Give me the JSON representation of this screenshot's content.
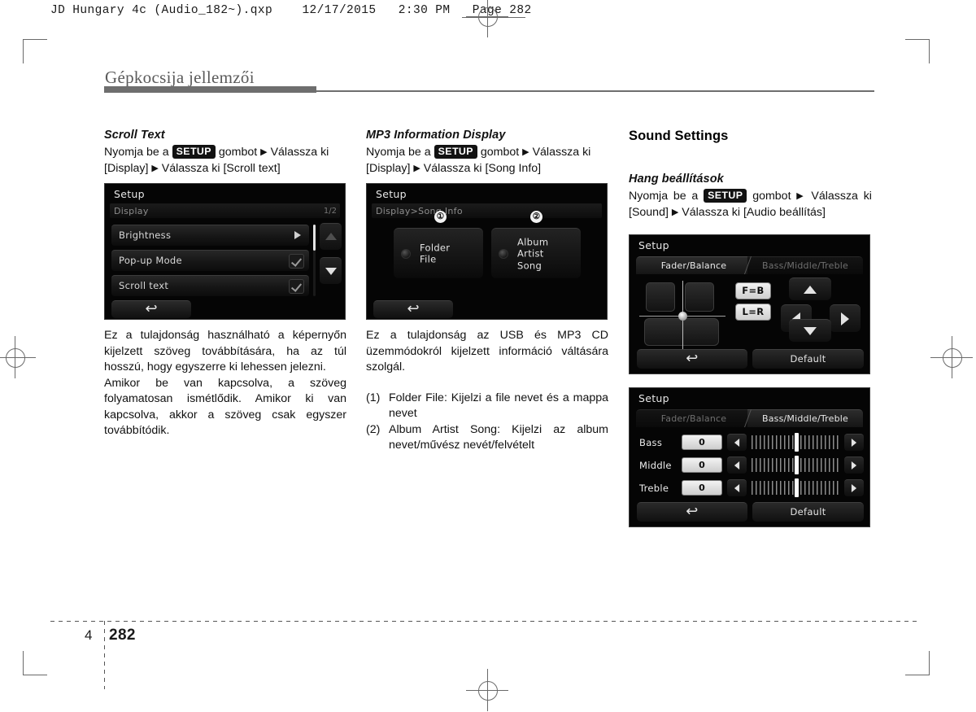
{
  "print_header": {
    "text": "JD Hungary 4c (Audio_182~).qxp    12/17/2015   2:30 PM   Page 282"
  },
  "chapter": {
    "title": "Gépkocsija jellemzői"
  },
  "footer": {
    "chapter_number": "4",
    "page_number": "282"
  },
  "columns": {
    "left": {
      "heading": "Scroll Text",
      "instruction": {
        "prefix": "Nyomja be a",
        "badge": "SETUP",
        "mid": "gombot",
        "step2": "Válassza ki [Display]",
        "step3": "Válassza ki [Scroll text]"
      },
      "paragraph_1": "Ez a tulajdonság használható a képernyőn kijelzett szöveg továbbítására, ha az túl hosszú, hogy egyszerre ki lehessen jelezni.",
      "paragraph_2": "Amikor be van kapcsolva, a szöveg folyamatosan ismétlődik. Amikor ki van kapcsolva, akkor a szöveg csak egyszer továbbítódik."
    },
    "middle": {
      "heading": "MP3 Information Display",
      "instruction": {
        "prefix": "Nyomja be a",
        "badge": "SETUP",
        "mid": "gombot",
        "step2": "Válassza ki [Display]",
        "step3": "Válassza ki [Song Info]"
      },
      "paragraph_1": "Ez a tulajdonság az USB és MP3 CD üzemmódokról kijelzett információ váltására szolgál.",
      "list": [
        {
          "label": "(1)",
          "text": "Folder File: Kijelzi a file nevet és a mappa nevet"
        },
        {
          "label": "(2)",
          "text": "Album Artist Song: Kijelzi az album nevet/művész nevét/felvételt"
        }
      ]
    },
    "right": {
      "heading": "Sound Settings",
      "subheading": "Hang beállítások",
      "instruction": {
        "prefix": "Nyomja be a",
        "badge": "SETUP",
        "mid": "gombot",
        "step2": "Válassza ki [Sound]",
        "step3": "Válassza ki [Audio beállítás]"
      }
    }
  },
  "screens": {
    "display": {
      "title": "Setup",
      "breadcrumb": "Display",
      "page_indicator": "1/2",
      "rows": [
        {
          "label": "Brightness",
          "control": "arrow"
        },
        {
          "label": "Pop-up Mode",
          "control": "check"
        },
        {
          "label": "Scroll text",
          "control": "check"
        }
      ],
      "back_icon": "back-arrow-icon",
      "scroll_up_icon": "scroll-up-icon",
      "scroll_down_icon": "scroll-down-icon"
    },
    "song_info": {
      "title": "Setup",
      "breadcrumb": "Display>Song Info",
      "options": [
        {
          "number": "1",
          "lines": [
            "Folder",
            "File"
          ]
        },
        {
          "number": "2",
          "lines": [
            "Album",
            "Artist",
            "Song"
          ]
        }
      ],
      "back_icon": "back-arrow-icon"
    },
    "fader_balance": {
      "title": "Setup",
      "tabs": [
        {
          "label": "Fader/Balance",
          "active": true
        },
        {
          "label": "Bass/Middle/Treble",
          "active": false
        }
      ],
      "buttons": {
        "fb": "F=B",
        "lr": "L=R",
        "default": "Default"
      },
      "back_icon": "back-arrow-icon"
    },
    "bass_middle_treble": {
      "title": "Setup",
      "tabs": [
        {
          "label": "Fader/Balance",
          "active": false
        },
        {
          "label": "Bass/Middle/Treble",
          "active": true
        }
      ],
      "rows": [
        {
          "label": "Bass",
          "value": "0"
        },
        {
          "label": "Middle",
          "value": "0"
        },
        {
          "label": "Treble",
          "value": "0"
        }
      ],
      "buttons": {
        "default": "Default"
      },
      "back_icon": "back-arrow-icon"
    }
  },
  "glyphs": {
    "triangle": "▶",
    "back_arrow": "⇦"
  },
  "colors": {
    "chapter_bar": "#6e6e6e",
    "screen_bg": "#050505",
    "badge_bg": "#121212"
  }
}
